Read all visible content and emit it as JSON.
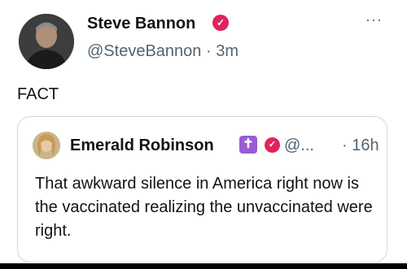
{
  "tweet": {
    "author_name": "Steve Bannon",
    "verified_mark": "✓",
    "handle": "@SteveBannon",
    "separator": "·",
    "time": "3m",
    "more_icon": "···",
    "text": "FACT"
  },
  "quote": {
    "author_name": "Emerald Robinson",
    "cross_badge": "✝",
    "verified_mark": "✓",
    "handle": "@...",
    "time": "· 16h",
    "text": "That awkward silence in America right now is the vaccinated realizing the unvaccinated were right."
  },
  "colors": {
    "verified": "#e0245e",
    "cross_badge": "#9a5bd5",
    "muted_text": "#536471",
    "border": "#cfd9de"
  }
}
